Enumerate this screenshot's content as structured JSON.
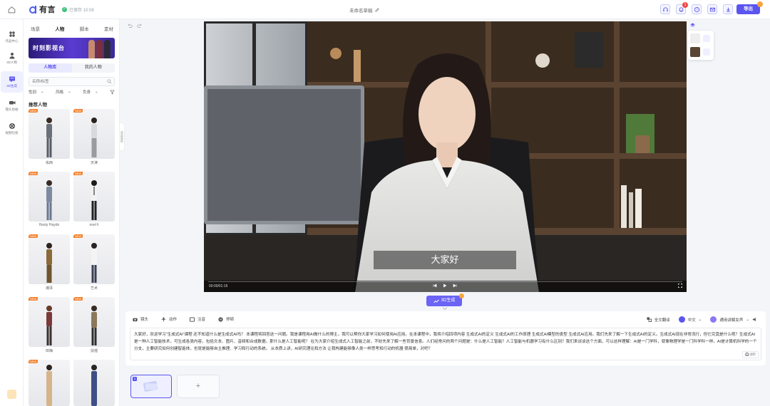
{
  "app": {
    "logo_text": "有言",
    "saved_status": "已保存 10:08",
    "doc_title": "未命名草稿",
    "export_label": "导出",
    "notification_count": "1",
    "accent_color": "#5b55f0"
  },
  "rail": {
    "items": [
      {
        "label": "作品中心",
        "icon": "grid-icon"
      },
      {
        "label": "3D人物",
        "icon": "person-icon"
      },
      {
        "label": "3D生成",
        "icon": "chat-box-icon"
      },
      {
        "label": "镜头仿拍",
        "icon": "camera-icon"
      },
      {
        "label": "视频包装",
        "icon": "film-reel-icon"
      }
    ]
  },
  "panel": {
    "tabs": [
      "场景",
      "人物",
      "脚本",
      "素材"
    ],
    "active_tab": "人物",
    "banner_text": "时刻影视台",
    "subtabs": [
      "人物库",
      "我的人物"
    ],
    "search_placeholder": "名称/标签",
    "filters": [
      "性别",
      "风格",
      "负身"
    ],
    "section_title": "推荐人物",
    "characters": [
      {
        "name": "佑西",
        "badge": "NEW"
      },
      {
        "name": "天津",
        "badge": "NEW"
      },
      {
        "name": "Hasty Haydn",
        "badge": "NEW"
      },
      {
        "name": "noel li",
        "badge": "NEW"
      },
      {
        "name": "潮泽",
        "badge": "NEW"
      },
      {
        "name": "艺术",
        "badge": "NEW"
      },
      {
        "name": "田梅",
        "badge": "NEW"
      },
      {
        "name": "扶摇",
        "badge": "NEW"
      },
      {
        "name": "",
        "badge": "NEW"
      },
      {
        "name": "",
        "badge": ""
      }
    ],
    "collapse_label": "收起面板"
  },
  "player": {
    "caption": "大家好",
    "time": "00:00/01:15"
  },
  "generate_label": "3D生成",
  "script": {
    "tools": [
      {
        "label": "镜头",
        "icon": "camera-icon"
      },
      {
        "label": "动作",
        "icon": "gesture-icon"
      },
      {
        "label": "注音",
        "icon": "phonetic-icon"
      },
      {
        "label": "停顿",
        "icon": "pause-icon"
      }
    ],
    "full_translate": "全文翻译",
    "language": "中文",
    "voice": "通用讲解女声",
    "text": "大家好，欢迎学习“生成式AI”课程 还不知道什么是生成式AI吗？ 本课程将回答这一问题。我是课程用AI做什么的博主，我可以帮你大家学习如何使用AI应用。在本课程中，我将介绍四项内容 生成式AI的定义 生成式AI的工作原理 生成式AI模型的类型 生成式AI应用。我们先来了解一下生成式AI的定义。生成式AI现在非常流行，但它究竟是什么呢？生成式AI是一种人工智能技术，可生成各类内容，包括文本、图片、音频和合成数据。那什么是人工智能呢？ 在为大家介绍生成式人工智能之前，不妨先来了解一些背景信息。人们经常问的两个问题是：什么是人工智能？人工智能与机器学习有什么区别？我们来谈谈这个方面，可以这样理解：AI是一门学科，就像物理学是一门科学科一样。AI是计算机科学的一个分支，主要研究如何创建智能体，也就是能够自主推理、学习和行动的系统。 从本质上讲，AI研究理论和方法 让我构建能够像人类一样思考和行动的机器 很简单，对吧？",
    "listen_label": "试听"
  },
  "scenes": {
    "items": [
      {
        "number": "1"
      }
    ],
    "add_label": "+"
  }
}
